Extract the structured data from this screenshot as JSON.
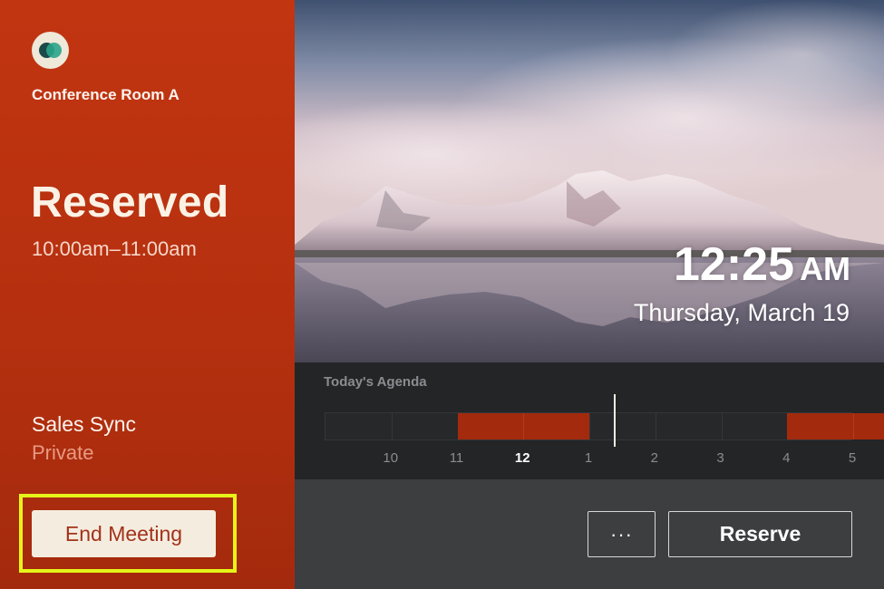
{
  "room": {
    "name": "Conference Room A"
  },
  "status": {
    "title": "Reserved",
    "time_range": "10:00am–11:00am",
    "meeting_name": "Sales Sync",
    "meeting_privacy": "Private",
    "end_button_label": "End Meeting"
  },
  "clock": {
    "time": "12:25",
    "ampm": "AM",
    "date": "Thursday, March 19"
  },
  "agenda": {
    "title": "Today's Agenda",
    "hours": [
      "10",
      "11",
      "12",
      "1",
      "2",
      "3",
      "4",
      "5"
    ],
    "current_hour": "12",
    "bookings": [
      {
        "start_hour": 10.0,
        "end_hour": 12.0
      },
      {
        "start_hour": 15.0,
        "end_hour": 16.5
      }
    ],
    "now_hour": 12.4
  },
  "actions": {
    "more_label": "···",
    "reserve_label": "Reserve"
  },
  "colors": {
    "status_reserved": "#b5300f",
    "booking_block": "#a42a0d",
    "highlight": "#e6f41a"
  },
  "icons": {
    "logo": "app-logo-icon",
    "more": "more-dots-icon"
  }
}
